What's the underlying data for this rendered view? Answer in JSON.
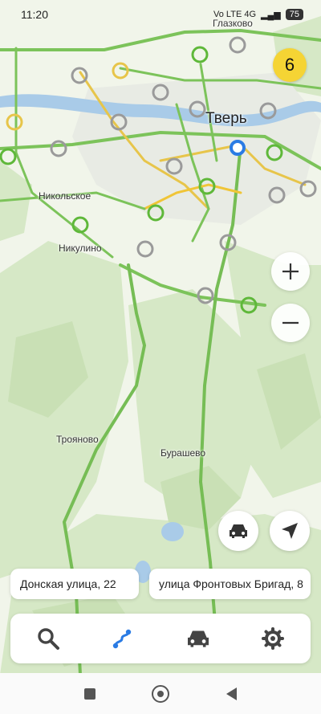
{
  "status_bar": {
    "time": "11:20",
    "network": "Vo LTE 4G",
    "battery": "75"
  },
  "map": {
    "labels": {
      "tver": "Тверь",
      "glazkovo": "Глазково",
      "nikolskoe": "Никольское",
      "nikulino": "Никулино",
      "troyanovo": "Трояново",
      "burashevo": "Бурашево"
    }
  },
  "traffic_score": "6",
  "zoom": {
    "in_label": "+",
    "out_label": "−"
  },
  "route_chips": {
    "from": "Донская улица, 22",
    "to": "улица Фронтовых Бригад, 8"
  },
  "toolbar": {
    "items": [
      "search",
      "route",
      "car",
      "settings"
    ]
  },
  "colors": {
    "accent": "#2a7be4",
    "traffic_green": "#5fb83a",
    "traffic_yellow": "#f0c537",
    "badge": "#f5d434"
  }
}
